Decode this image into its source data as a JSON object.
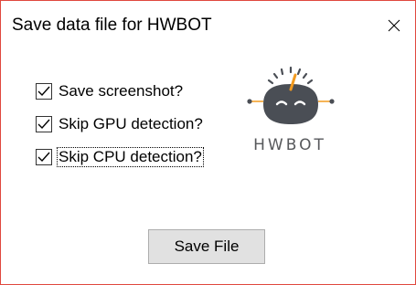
{
  "window": {
    "title": "Save data file for HWBOT",
    "border_color": "#e0483e"
  },
  "options": [
    {
      "label": "Save screenshot?",
      "checked": true
    },
    {
      "label": "Skip GPU detection?",
      "checked": true
    },
    {
      "label": "Skip CPU detection?",
      "checked": true,
      "focused": true
    }
  ],
  "logo": {
    "text": "HWBOT",
    "icon": "hwbot-robot-logo",
    "colors": {
      "head": "#4a4e55",
      "accent": "#f39a1e"
    }
  },
  "save_button": {
    "label": "Save File"
  },
  "icons": {
    "close": "close-icon",
    "check": "check-icon"
  }
}
